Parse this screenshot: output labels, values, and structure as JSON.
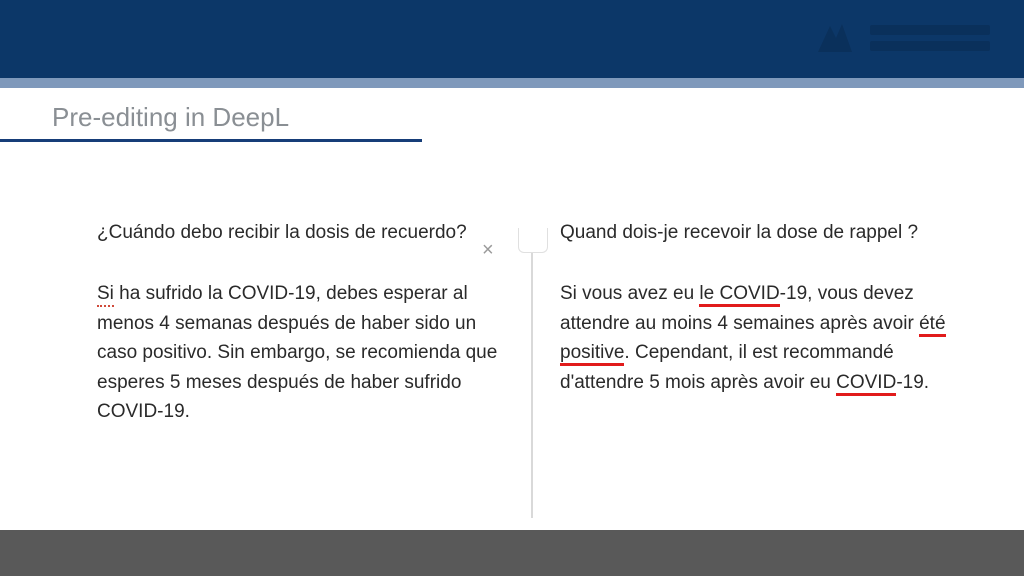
{
  "slide": {
    "title": "Pre-editing in DeepL"
  },
  "left": {
    "question": "¿Cuándo debo recibir la dosis de recuerdo?",
    "body_pre": "",
    "spell_word": "Si",
    "body_post": " ha sufrido la COVID-19, debes esperar al menos 4 semanas después de haber sido un caso positivo. Sin embargo, se recomienda que esperes 5 meses después de haber sufrido COVID-19."
  },
  "right": {
    "question": "Quand dois-je recevoir la dose de rappel ?",
    "seg1": "Si vous avez eu ",
    "ul1": "le COVID",
    "seg2": "-19, vous devez attendre au moins 4 semaines après avoir ",
    "ul2": "été positive",
    "seg3": ". Cependant, il est recommandé d'attendre 5 mois après avoir eu ",
    "ul3": "COVID",
    "seg4": "-19."
  },
  "icons": {
    "clear": "×"
  }
}
